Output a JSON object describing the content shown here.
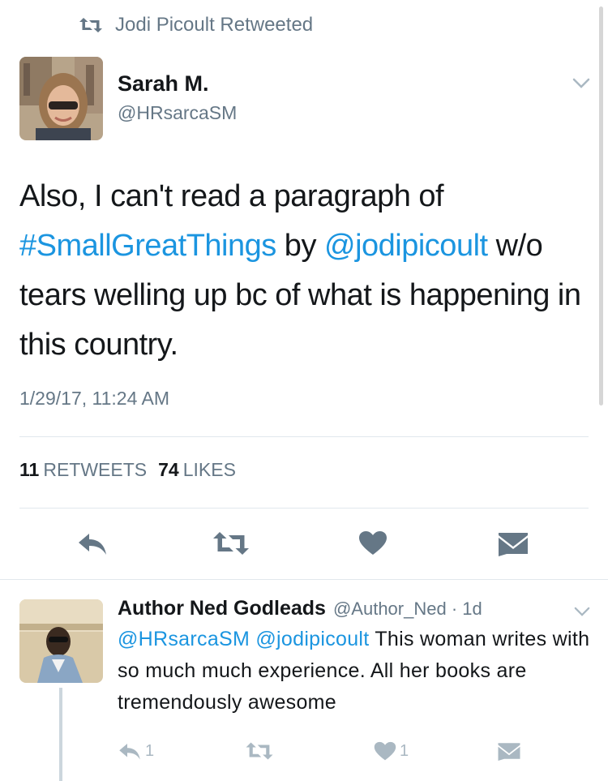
{
  "retweet_banner": {
    "text": "Jodi Picoult Retweeted",
    "icon": "retweet-icon"
  },
  "tweet": {
    "author_name": "Sarah M.",
    "author_handle": "@HRsarcaSM",
    "text_parts": {
      "p1": "Also, I can't read a paragraph of ",
      "hashtag": "#SmallGreatThings",
      "p2": " by ",
      "mention": "@jodipicoult",
      "p3": " w/o tears welling up bc of what is happening in this country."
    },
    "timestamp": "1/29/17, 11:24 AM",
    "retweets_count": "11",
    "retweets_label": "RETWEETS",
    "likes_count": "74",
    "likes_label": "LIKES",
    "actions": [
      "reply-icon",
      "retweet-icon",
      "heart-icon",
      "message-icon"
    ]
  },
  "reply": {
    "author_name": "Author Ned Godleads",
    "meta": "@Author_Ned · 1d",
    "mention1": "@HRsarcaSM",
    "mention2": "@jodipicoult",
    "text": " This woman writes with so much much experience. All her books are tremendously awesome",
    "reply_count": "1",
    "like_count": "1"
  },
  "colors": {
    "link": "#1b95e0",
    "muted": "#657786",
    "icon_main": "#657786",
    "icon_reply": "#aab8c2",
    "divider": "#e1e8ed"
  }
}
